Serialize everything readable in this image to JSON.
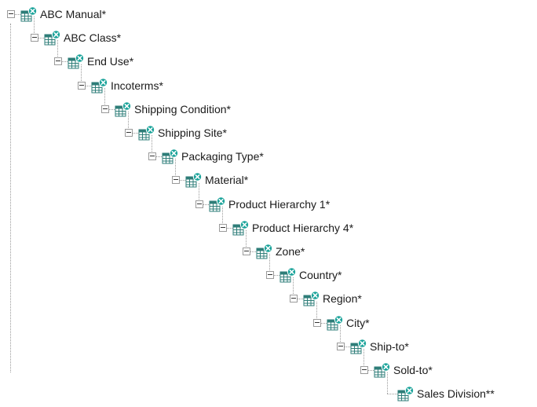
{
  "tree": {
    "nodes": [
      {
        "label": "ABC Manual*",
        "icon": "table-remove-icon",
        "expanded": true
      },
      {
        "label": "ABC Class*",
        "icon": "table-remove-icon",
        "expanded": true
      },
      {
        "label": "End Use*",
        "icon": "table-remove-icon",
        "expanded": true
      },
      {
        "label": "Incoterms*",
        "icon": "table-remove-icon",
        "expanded": true
      },
      {
        "label": "Shipping Condition*",
        "icon": "table-remove-icon",
        "expanded": true
      },
      {
        "label": "Shipping Site*",
        "icon": "table-remove-icon",
        "expanded": true
      },
      {
        "label": "Packaging Type*",
        "icon": "table-remove-icon",
        "expanded": true
      },
      {
        "label": "Material*",
        "icon": "table-remove-icon",
        "expanded": true
      },
      {
        "label": "Product Hierarchy 1*",
        "icon": "table-remove-icon",
        "expanded": true
      },
      {
        "label": "Product Hierarchy 4*",
        "icon": "table-remove-icon",
        "expanded": true
      },
      {
        "label": "Zone*",
        "icon": "table-remove-icon",
        "expanded": true
      },
      {
        "label": "Country*",
        "icon": "table-remove-icon",
        "expanded": true
      },
      {
        "label": "Region*",
        "icon": "table-remove-icon",
        "expanded": true
      },
      {
        "label": "City*",
        "icon": "table-remove-icon",
        "expanded": true
      },
      {
        "label": "Ship-to*",
        "icon": "table-remove-icon",
        "expanded": true
      },
      {
        "label": "Sold-to*",
        "icon": "table-remove-icon",
        "expanded": true
      },
      {
        "label": "Sales Division**",
        "icon": "table-remove-icon",
        "expanded": false
      }
    ]
  },
  "colors": {
    "icon_teal": "#1aa39a",
    "icon_grid": "#2e7d78",
    "connector": "#9a9a9a",
    "text": "#1a1a1a"
  }
}
